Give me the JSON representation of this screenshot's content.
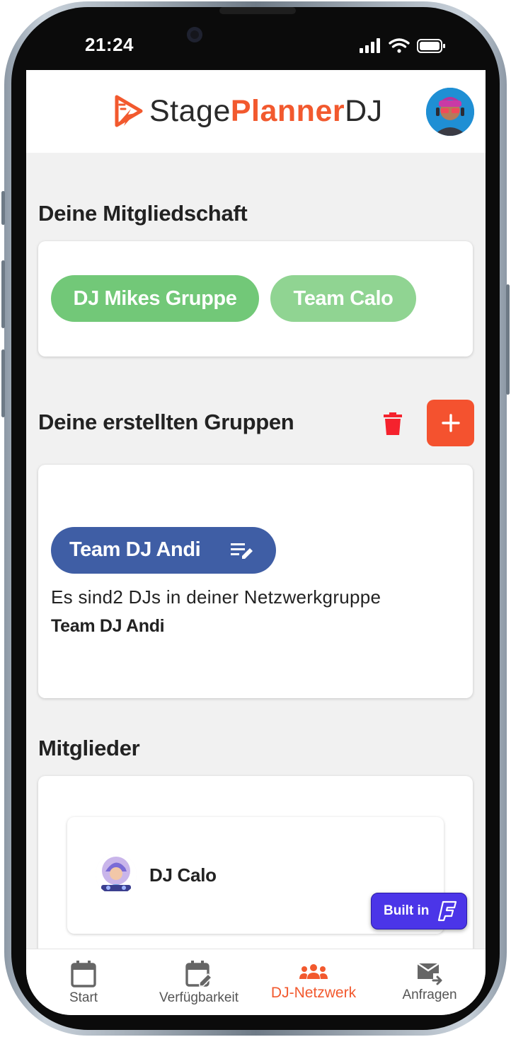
{
  "status_bar": {
    "time": "21:24"
  },
  "header": {
    "logo": {
      "part1": "Stage",
      "part2": "Planner",
      "part3": "DJ"
    }
  },
  "membership": {
    "title": "Deine Mitgliedschaft",
    "chips": [
      "DJ Mikes Gruppe",
      "Team Calo"
    ]
  },
  "created_groups": {
    "title": "Deine erstellten Gruppen",
    "group": {
      "name": "Team DJ Andi",
      "info": "Es sind2 DJs in deiner Netzwerkgruppe",
      "name_bold": "Team DJ Andi"
    }
  },
  "members": {
    "title": "Mitglieder",
    "items": [
      {
        "name": "DJ Calo",
        "icon": "dj-avatar-icon"
      }
    ]
  },
  "badge": {
    "label": "Built in"
  },
  "bottom_nav": {
    "items": [
      {
        "label": "Start",
        "icon": "calendar-icon"
      },
      {
        "label": "Verfügbarkeit",
        "icon": "calendar-edit-icon"
      },
      {
        "label": "DJ-Netzwerk",
        "icon": "groups-icon",
        "active": true
      },
      {
        "label": "Anfragen",
        "icon": "forward-mail-icon"
      }
    ]
  },
  "colors": {
    "accent": "#f2592e",
    "green_chip": "#72c878",
    "green_chip_light": "#90d492",
    "group_chip": "#3f5ea5",
    "delete_red": "#f5222d",
    "badge_purple": "#4b35e8"
  }
}
